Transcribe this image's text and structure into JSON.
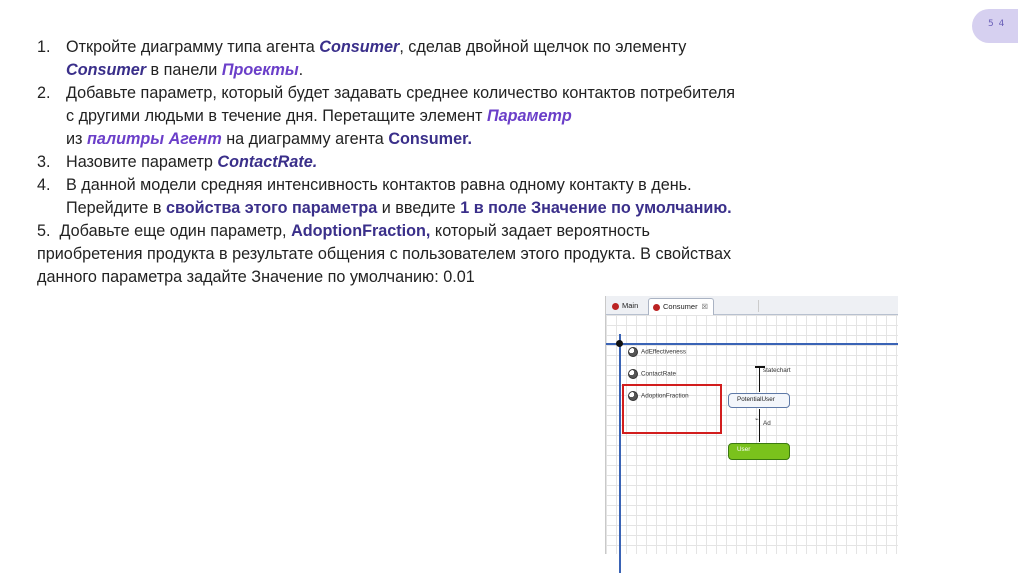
{
  "page_number": "5 4",
  "items": [
    {
      "num": "1.",
      "t1": "Откройте диаграмму типа агента ",
      "b1": "Consumer",
      "t2": ", сделав двойной щелчок по элементу",
      "b2": "Consumer",
      "t3": " в панели ",
      "b3": "Проекты",
      "t4": "."
    },
    {
      "num": "2.",
      "t1": "Добавьте параметр, который будет задавать среднее количество контактов потребителя с другими людьми в течение дня. Перетащите элемент ",
      "b1": "Параметр",
      "t2": "из ",
      "b2": "палитры Агент",
      "t3": " на диаграмму агента ",
      "b3": "Consumer.",
      "t4": ""
    },
    {
      "num": "3.",
      "t1": "Назовите параметр ",
      "b1": "ContactRate."
    },
    {
      "num": "4.",
      "t1": "В данной модели средняя интенсивность контактов равна одному контакту в день. Перейдите в ",
      "b1": "свойства этого параметра",
      "t2": " и введите ",
      "b2": "1 в поле Значение по умолчанию."
    },
    {
      "num": "5.",
      "t1": "Добавьте еще один параметр, ",
      "b1": "AdoptionFraction,",
      "t2": " который задает вероятность приобретения продукта в результате общения с пользователем этого продукта. В свойствах данного параметра задайте Значение по умолчанию: 0.01"
    }
  ],
  "screenshot": {
    "tabs": [
      "Main",
      "Consumer"
    ],
    "tab_close": "☒",
    "params": [
      "AdEffectiveness",
      "ContactRate",
      "AdoptionFraction"
    ],
    "statechart_label": "statechart",
    "state1": "PotentialUser",
    "transition_label": "Ad",
    "state2": "User"
  }
}
